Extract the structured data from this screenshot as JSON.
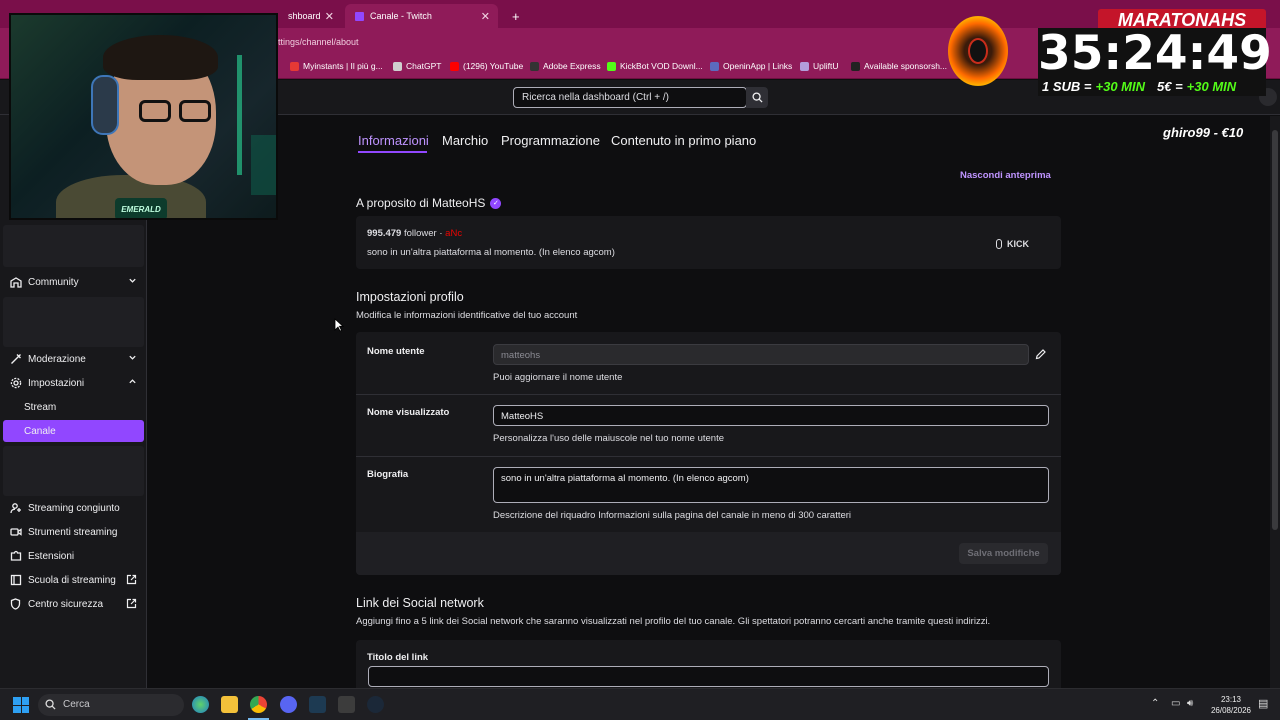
{
  "browser": {
    "tabs": [
      {
        "label": "shboard",
        "active": false
      },
      {
        "label": "Canale - Twitch",
        "active": true
      }
    ],
    "new_tab": "+",
    "url": "ttings/channel/about",
    "bookmarks": [
      {
        "label": "Myinstants | Il più g...",
        "color": "#e53935"
      },
      {
        "label": "ChatGPT",
        "color": "#cfcfcf"
      },
      {
        "label": "(1296) YouTube",
        "color": "#ff0000"
      },
      {
        "label": "Adobe Express",
        "color": "#333333"
      },
      {
        "label": "KickBot VOD Downl...",
        "color": "#53fc18"
      },
      {
        "label": "OpeninApp | Links",
        "color": "#5c6bc0"
      },
      {
        "label": "UpliftU",
        "color": "#b39ddb"
      },
      {
        "label": "Available sponsorsh...",
        "color": "#222222"
      }
    ]
  },
  "header": {
    "search_placeholder": "Ricerca nella dashboard (Ctrl + /)"
  },
  "sidebar": {
    "community": "Community",
    "moderazione": "Moderazione",
    "impostazioni": "Impostazioni",
    "stream": "Stream",
    "canale": "Canale",
    "streaming_congiunto": "Streaming congiunto",
    "strumenti_streaming": "Strumenti streaming",
    "estensioni": "Estensioni",
    "scuola": "Scuola di streaming",
    "centro_sicurezza": "Centro sicurezza"
  },
  "tabs": {
    "informazioni": "Informazioni",
    "marchio": "Marchio",
    "programmazione": "Programmazione",
    "contenuto": "Contenuto in primo piano"
  },
  "preview": {
    "hide_label": "Nascondi anteprima",
    "about_title": "A proposito di MatteoHS",
    "followers_count": "995.479",
    "followers_label": "follower ·",
    "team": "aNc",
    "bio_text": "sono in un'altra piattaforma al momento. (In elenco agcom)",
    "kick_label": "KICK"
  },
  "profile": {
    "title": "Impostazioni profilo",
    "subtitle": "Modifica le informazioni identificative del tuo account",
    "username_label": "Nome utente",
    "username_value": "matteohs",
    "username_help": "Puoi aggiornare il nome utente",
    "display_label": "Nome visualizzato",
    "display_value": "MatteoHS",
    "display_help": "Personalizza l'uso delle maiuscole nel tuo nome utente",
    "bio_label": "Biografia",
    "bio_value": "sono in un'altra piattaforma al momento. (In elenco agcom)",
    "bio_help": "Descrizione del riquadro Informazioni sulla pagina del canale in meno di 300 caratteri",
    "save_label": "Salva modifiche"
  },
  "social": {
    "title": "Link dei Social network",
    "subtitle": "Aggiungi fino a 5 link dei Social network che saranno visualizzati nel profilo del tuo canale. Gli spettatori potranno cercarti anche tramite questi indirizzi.",
    "link_title_label": "Titolo del link"
  },
  "overlay": {
    "marathon": "MARATONAHS",
    "time": "35:24:49",
    "sub_rule_prefix": "1 SUB =",
    "sub_rule_value": "+30 MIN",
    "euro_rule_prefix": "5€ =",
    "euro_rule_value": "+30 MIN",
    "donation": "ghiro99 - €10",
    "cam_logo": "EMERALD"
  },
  "taskbar": {
    "search": "Cerca",
    "time": "23:13",
    "date": "26/08/2026"
  }
}
